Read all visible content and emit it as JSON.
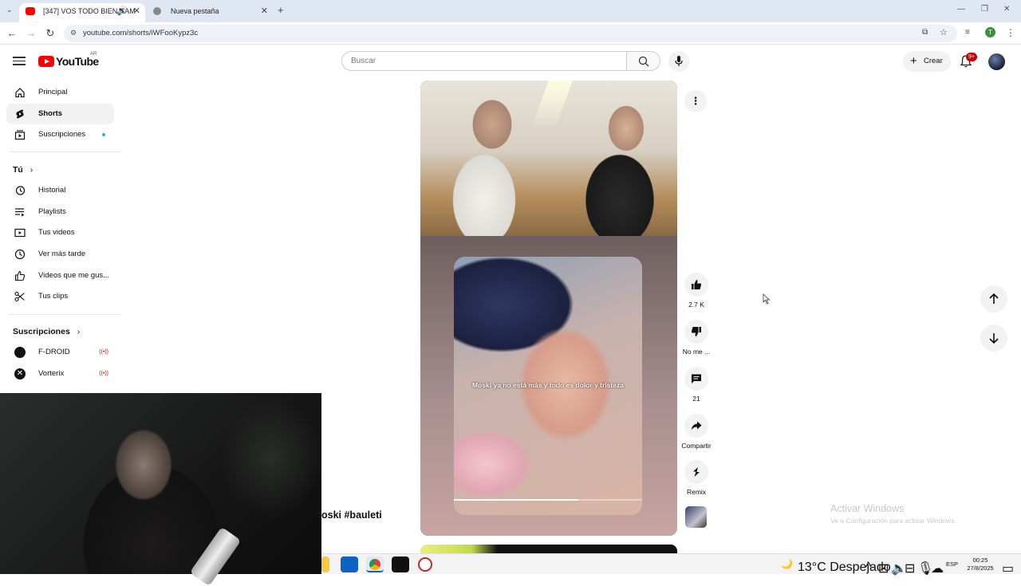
{
  "browser": {
    "tabs": [
      {
        "title": "[347] VOS TODO BIEN CAM",
        "active": true
      },
      {
        "title": "Nueva pestaña",
        "active": false
      }
    ],
    "url": "youtube.com/shorts/iWFooKypz3c",
    "profile_initial": "T"
  },
  "header": {
    "logo_text": "YouTube",
    "country_code": "AR",
    "search_placeholder": "Buscar",
    "create_label": "Crear",
    "notifications_badge": "9+"
  },
  "sidebar": {
    "main": [
      {
        "label": "Principal",
        "icon": "home-icon"
      },
      {
        "label": "Shorts",
        "icon": "shorts-icon",
        "active": true
      },
      {
        "label": "Suscripciones",
        "icon": "subscriptions-icon"
      }
    ],
    "you_heading": "Tú",
    "you": [
      {
        "label": "Historial",
        "icon": "history-icon"
      },
      {
        "label": "Playlists",
        "icon": "playlists-icon"
      },
      {
        "label": "Tus videos",
        "icon": "your-videos-icon"
      },
      {
        "label": "Ver más tarde",
        "icon": "watch-later-icon"
      },
      {
        "label": "Videos que me gus...",
        "icon": "liked-icon"
      },
      {
        "label": "Tus clips",
        "icon": "clips-icon"
      }
    ],
    "subs_heading": "Suscripciones",
    "subs": [
      {
        "label": "F-DROID",
        "live": "((•))"
      },
      {
        "label": "Vorterix",
        "live": "((•))"
      }
    ]
  },
  "short": {
    "caption": "Moski ya no está más y todo es dolor y tristeza",
    "hashtags": "oski #bauleti",
    "progress": 0.66
  },
  "actions": {
    "like_count": "2.7 K",
    "dislike_label": "No me ...",
    "comments_count": "21",
    "share_label": "Compartir",
    "remix_label": "Remix"
  },
  "windows": {
    "activate_title": "Activar Windows",
    "activate_sub": "Ve a Configuración para activar Windows.",
    "weather": "13°C  Despejado",
    "lang": "ESP",
    "time": "00:25",
    "date": "27/8/2025"
  },
  "colors": {
    "brand_red": "#ff0000",
    "badge_red": "#cc0000",
    "accent_blue": "#3ea6ff"
  }
}
